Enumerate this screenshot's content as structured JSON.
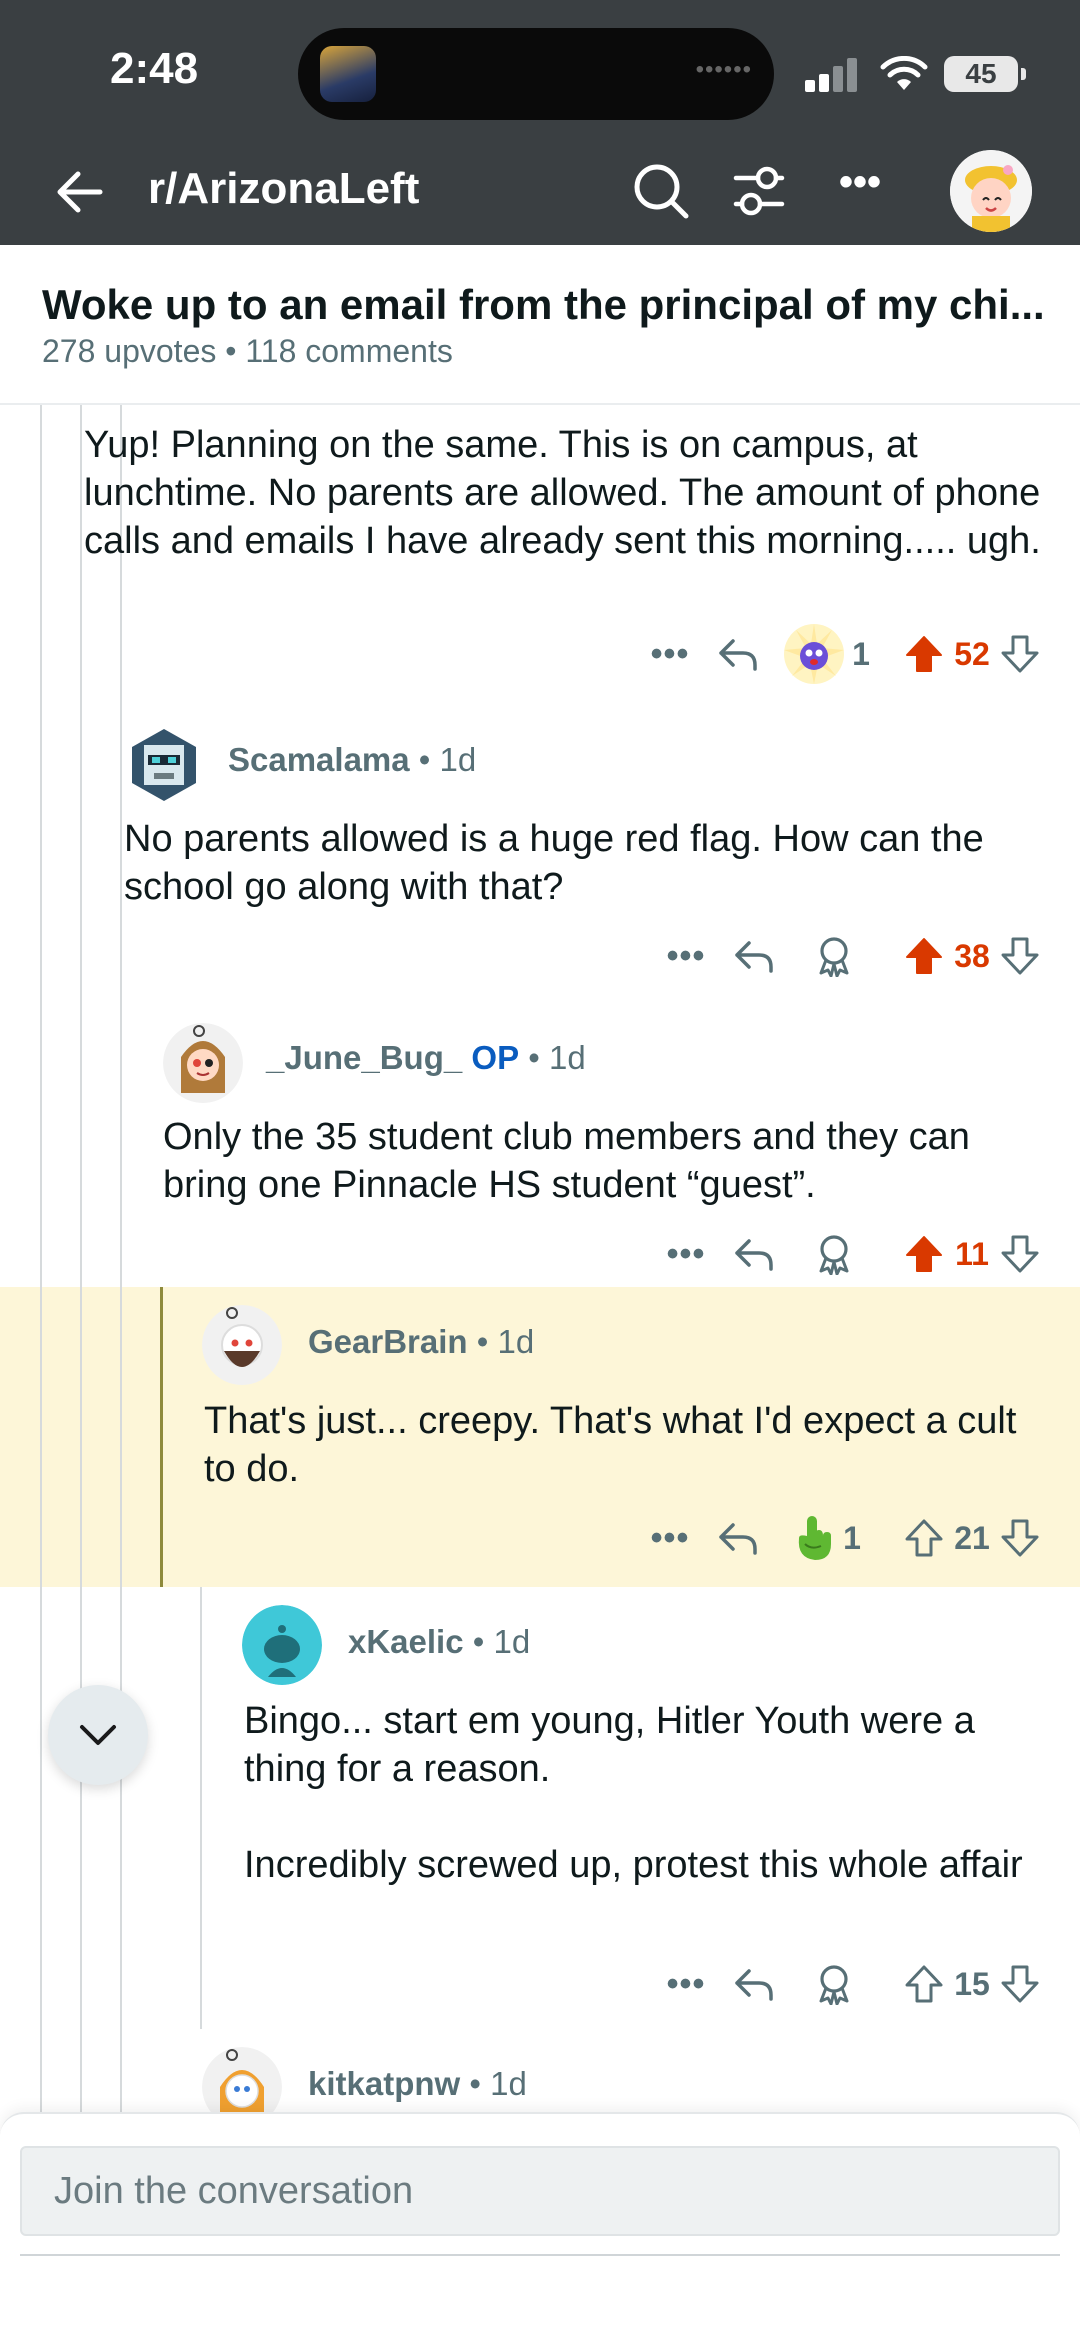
{
  "status_bar": {
    "time": "2:48",
    "battery": "45"
  },
  "nav": {
    "subreddit": "r/ArizonaLeft"
  },
  "post": {
    "title": "Woke up to an email from the principal of my chi...",
    "upvotes": "278 upvotes",
    "comments": "118 comments"
  },
  "comments": [
    {
      "body": "Yup! Planning on the same. This is on campus, at lunchtime. No parents are allowed. The amount of phone calls and emails I have already sent this morning..... ugh.",
      "award_count": "1",
      "score": "52"
    },
    {
      "author": "Scamalama",
      "age": "1d",
      "body": "No parents allowed is a huge red flag. How can the school go along with that?",
      "score": "38"
    },
    {
      "author": "_June_Bug_",
      "op_label": "OP",
      "age": "1d",
      "body": "Only the 35 student club members and they can bring one Pinnacle HS student “guest”.",
      "score": "11"
    },
    {
      "author": "GearBrain",
      "age": "1d",
      "body": "That's just... creepy.  That's what I'd expect a cult to do.",
      "award_count": "1",
      "score": "21"
    },
    {
      "author": "xKaelic",
      "age": "1d",
      "body": "Bingo... start em young, Hitler Youth were a thing for a reason.\n\nIncredibly screwed up, protest this whole affair",
      "score": "15"
    },
    {
      "author": "kitkatpnw",
      "age": "1d"
    }
  ],
  "compose": {
    "placeholder": "Join the conversation"
  },
  "colors": {
    "header_bg": "#3a3f42",
    "upvote_active": "#d93900",
    "highlight_bg": "#fdf6d8",
    "op_blue": "#0a5cbf",
    "meta_gray": "#576f76"
  },
  "icons": [
    "back-arrow-icon",
    "search-icon",
    "filter-icon",
    "more-icon",
    "reply-icon",
    "award-icon",
    "upvote-icon",
    "downvote-icon",
    "chevron-down-icon"
  ]
}
